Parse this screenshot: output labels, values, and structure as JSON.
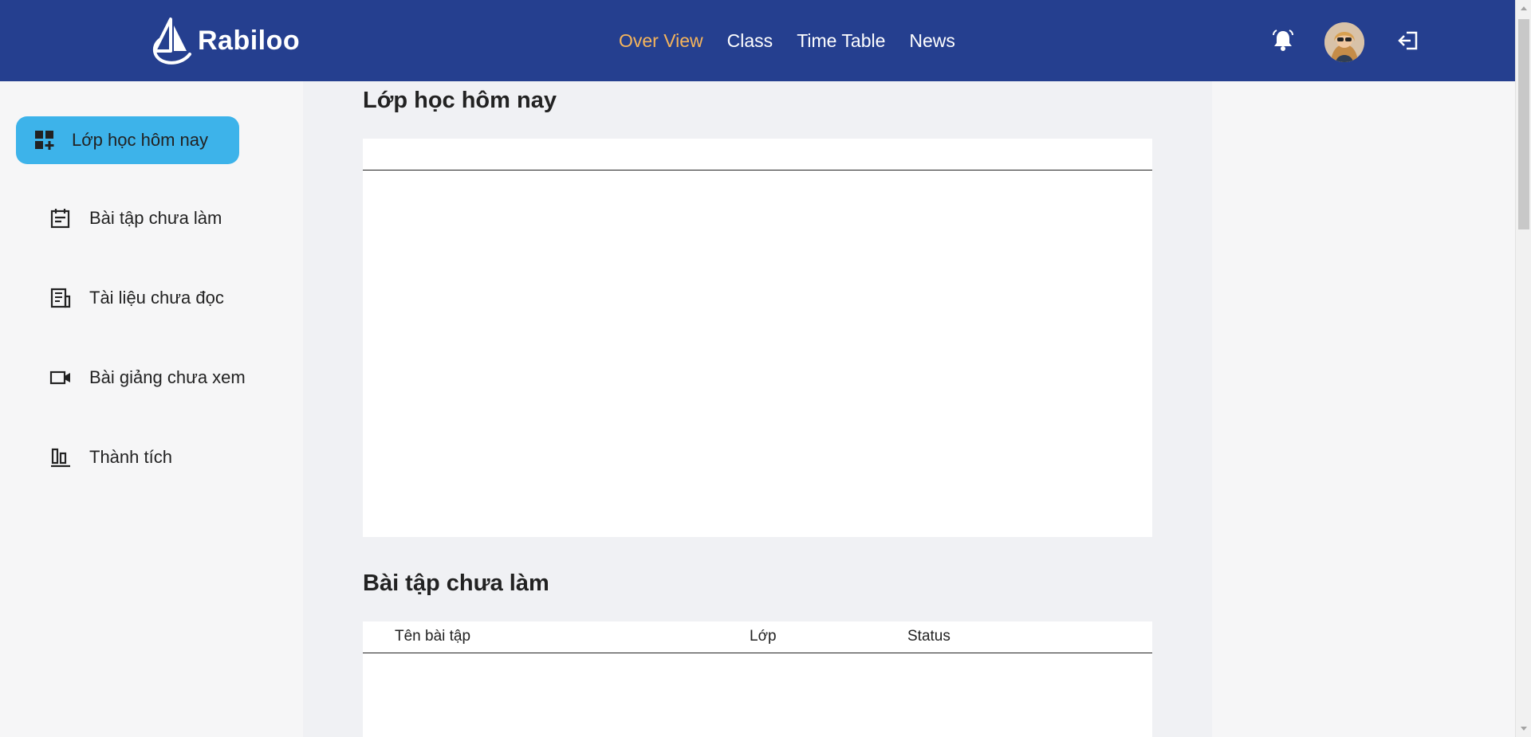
{
  "brand": {
    "name": "Rabiloo"
  },
  "nav": {
    "items": [
      {
        "label": "Over View",
        "active": true
      },
      {
        "label": "Class",
        "active": false
      },
      {
        "label": "Time Table",
        "active": false
      },
      {
        "label": "News",
        "active": false
      }
    ]
  },
  "header_icons": {
    "bell": "bell-icon",
    "avatar": "avatar",
    "logout": "logout-icon"
  },
  "sidebar": {
    "items": [
      {
        "label": "Lớp học hôm nay",
        "icon": "dashboard-add-icon",
        "active": true
      },
      {
        "label": "Bài tập chưa làm",
        "icon": "calendar-note-icon",
        "active": false
      },
      {
        "label": "Tài liệu chưa đọc",
        "icon": "document-icon",
        "active": false
      },
      {
        "label": "Bài giảng chưa xem",
        "icon": "video-camera-icon",
        "active": false
      },
      {
        "label": "Thành tích",
        "icon": "bar-chart-icon",
        "active": false
      }
    ]
  },
  "main": {
    "today_classes": {
      "title": "Lớp học hôm nay"
    },
    "pending_homework": {
      "title": "Bài tập chưa làm",
      "columns": [
        "Tên bài tập",
        "Lớp",
        "Status"
      ]
    }
  },
  "colors": {
    "header_bg": "#253f8f",
    "nav_active": "#f6b55b",
    "sidebar_active_bg": "#3db3ea",
    "main_bg": "#f0f1f4"
  }
}
